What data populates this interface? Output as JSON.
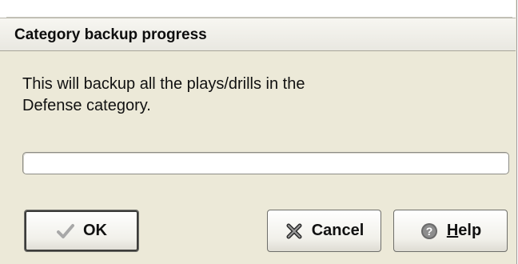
{
  "dialog": {
    "title": "Category backup progress",
    "message": "This will backup all the plays/drills in the\nDefense category."
  },
  "progress": {
    "value": 0
  },
  "buttons": {
    "ok": {
      "label": "OK",
      "icon": "checkmark-icon"
    },
    "cancel": {
      "label": "Cancel",
      "icon": "cross-icon"
    },
    "help": {
      "label_accel": "H",
      "label_rest": "elp",
      "icon": "help-icon"
    }
  }
}
